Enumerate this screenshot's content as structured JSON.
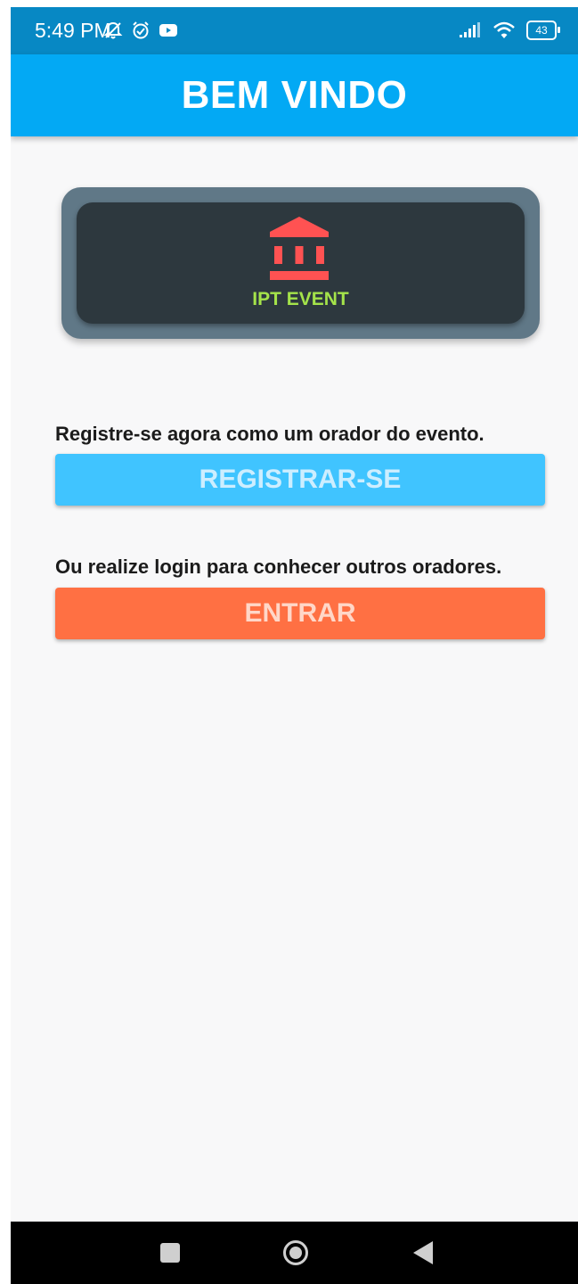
{
  "status_bar": {
    "time": "5:49 PM",
    "battery": "43",
    "icons": [
      "notifications-off-icon",
      "alarm-icon",
      "youtube-icon",
      "signal-icon",
      "wifi-icon",
      "battery-icon"
    ]
  },
  "app_bar": {
    "title": "BEM VINDO"
  },
  "logo": {
    "icon": "bank-icon",
    "text": "IPT EVENT"
  },
  "register": {
    "prompt": "Registre-se agora como um orador do evento.",
    "button_label": "REGISTRAR-SE"
  },
  "login": {
    "prompt": "Ou realize login para conhecer outros oradores.",
    "button_label": "ENTRAR"
  },
  "nav_bar": {
    "icons": [
      "recents-icon",
      "home-icon",
      "back-icon"
    ]
  },
  "colors": {
    "status_bar": "#0788c4",
    "app_bar": "#03a9f4",
    "register_button": "#40c4ff",
    "login_button": "#ff7043",
    "logo_text": "#a4e34a",
    "bank_icon": "#ff5252"
  }
}
